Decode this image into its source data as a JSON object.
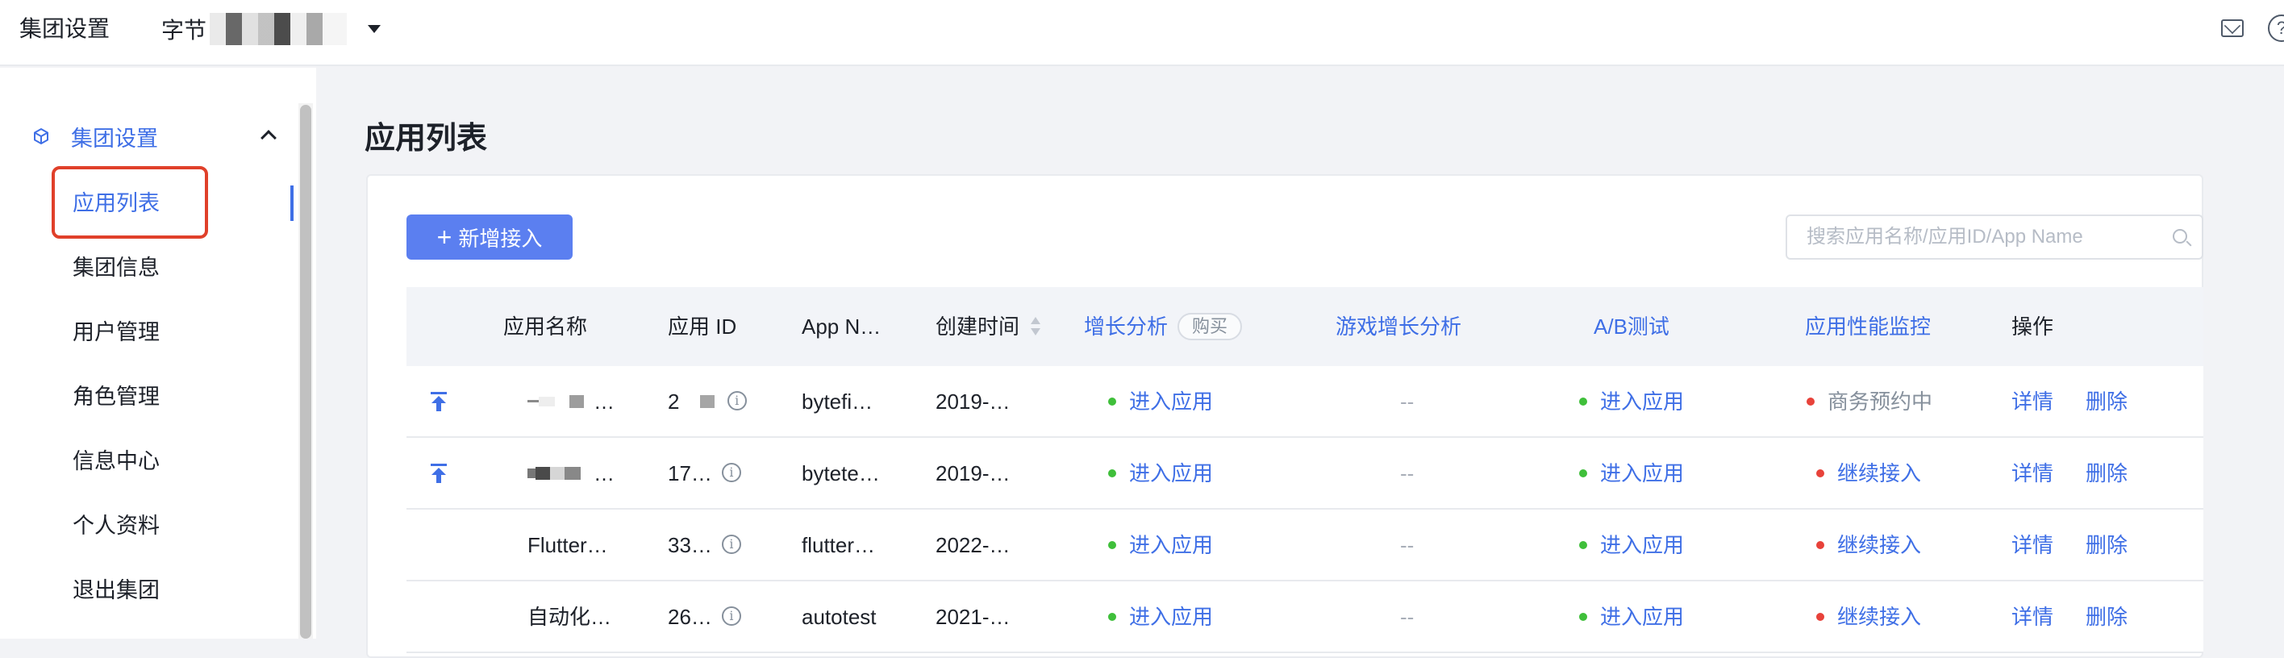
{
  "topbar": {
    "title": "集团设置",
    "org_name": "字节"
  },
  "sidebar": {
    "group_label": "集团设置",
    "items": [
      {
        "label": "应用列表"
      },
      {
        "label": "集团信息"
      },
      {
        "label": "用户管理"
      },
      {
        "label": "角色管理"
      },
      {
        "label": "信息中心"
      },
      {
        "label": "个人资料"
      },
      {
        "label": "退出集团"
      }
    ]
  },
  "main": {
    "page_title": "应用列表",
    "add_button": "新增接入",
    "search_placeholder": "搜索应用名称/应用ID/App Name"
  },
  "table": {
    "headers": {
      "name": "应用名称",
      "id": "应用 ID",
      "app_name": "App N…",
      "created": "创建时间",
      "growth": "增长分析",
      "growth_tag": "购买",
      "game": "游戏增长分析",
      "ab": "A/B测试",
      "apm": "应用性能监控",
      "ops": "操作"
    },
    "rows": [
      {
        "name": "…",
        "id": "2",
        "app_name": "bytefi…",
        "created": "2019-…",
        "growth": "进入应用",
        "game": "--",
        "ab": "进入应用",
        "apm": "商务预约中",
        "detail": "详情",
        "delete": "删除"
      },
      {
        "name": "…",
        "id": "17…",
        "app_name": "bytete…",
        "created": "2019-…",
        "growth": "进入应用",
        "game": "--",
        "ab": "进入应用",
        "apm": "继续接入",
        "detail": "详情",
        "delete": "删除"
      },
      {
        "name": "Flutter…",
        "id": "33…",
        "app_name": "flutter…",
        "created": "2022-…",
        "growth": "进入应用",
        "game": "--",
        "ab": "进入应用",
        "apm": "继续接入",
        "detail": "详情",
        "delete": "删除"
      },
      {
        "name": "自动化…",
        "id": "26…",
        "app_name": "autotest",
        "created": "2021-…",
        "growth": "进入应用",
        "game": "--",
        "ab": "进入应用",
        "apm": "继续接入",
        "detail": "详情",
        "delete": "删除"
      }
    ]
  },
  "colors": {
    "accent": "#3f6fe6",
    "button": "#5b7ff0",
    "status_green": "#3fbf3a",
    "status_red": "#e8423a",
    "highlight": "#e0402a"
  }
}
